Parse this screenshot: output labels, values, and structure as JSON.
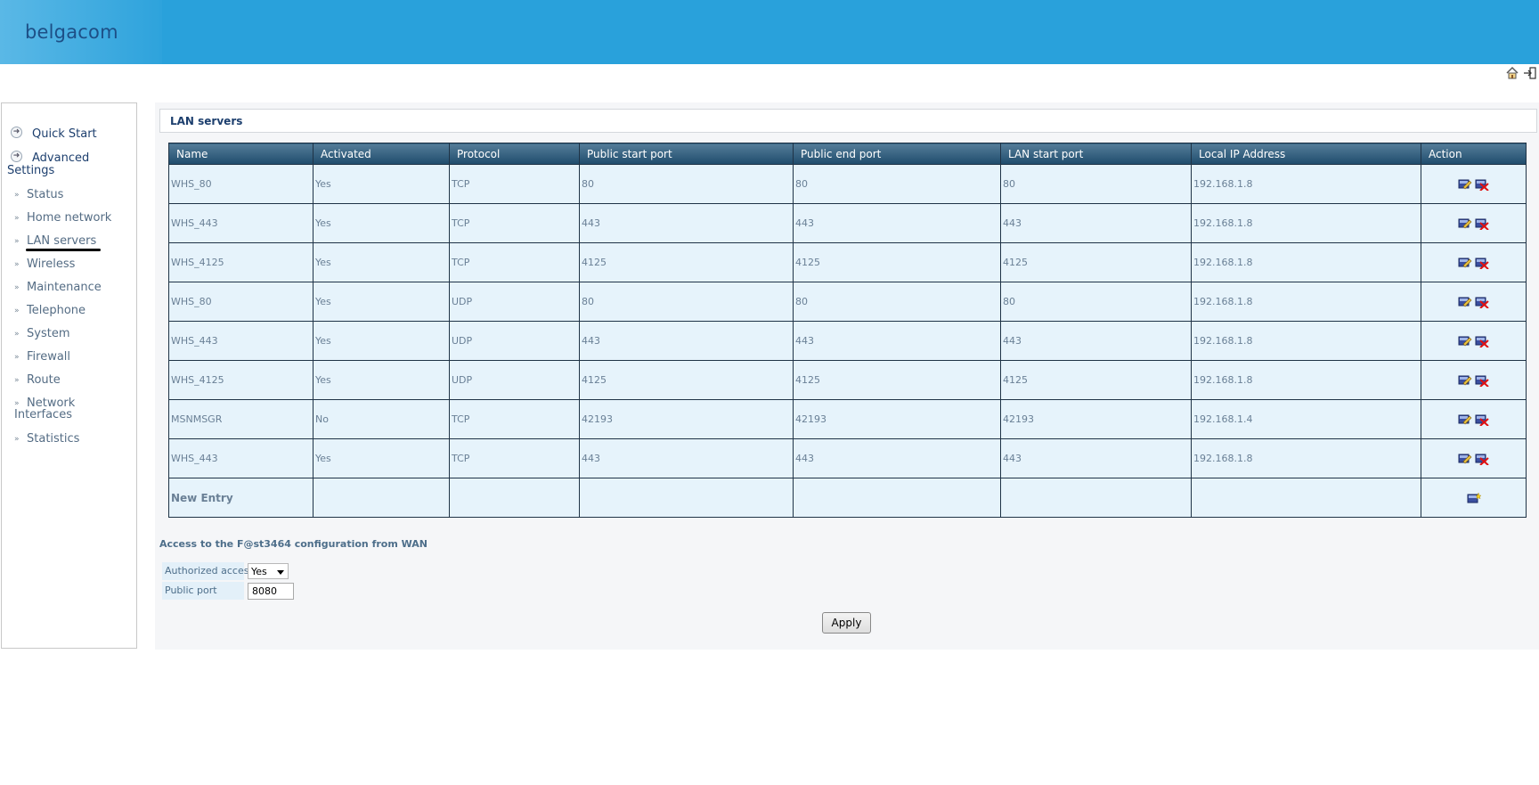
{
  "header": {
    "logo_text": "belgacom"
  },
  "top_icons": {
    "home": "home-icon",
    "logout": "logout-icon"
  },
  "sidebar": {
    "main": [
      {
        "label": "Quick Start"
      },
      {
        "label_line1": "Advanced",
        "label_line2": "Settings"
      }
    ],
    "items": [
      {
        "label": "Status"
      },
      {
        "label": "Home network"
      },
      {
        "label": "LAN servers"
      },
      {
        "label": "Wireless"
      },
      {
        "label": "Maintenance"
      },
      {
        "label": "Telephone"
      },
      {
        "label": "System"
      },
      {
        "label": "Firewall"
      },
      {
        "label": "Route"
      },
      {
        "label_line1": "Network",
        "label_line2": "Interfaces"
      },
      {
        "label": "Statistics"
      }
    ]
  },
  "page": {
    "title": "LAN servers"
  },
  "table": {
    "headers": [
      "Name",
      "Activated",
      "Protocol",
      "Public start port",
      "Public end port",
      "LAN start port",
      "Local IP Address",
      "Action"
    ],
    "rows": [
      {
        "name": "WHS_80",
        "activated": "Yes",
        "protocol": "TCP",
        "public_start": "80",
        "public_end": "80",
        "lan_start": "80",
        "ip": "192.168.1.8"
      },
      {
        "name": "WHS_443",
        "activated": "Yes",
        "protocol": "TCP",
        "public_start": "443",
        "public_end": "443",
        "lan_start": "443",
        "ip": "192.168.1.8"
      },
      {
        "name": "WHS_4125",
        "activated": "Yes",
        "protocol": "TCP",
        "public_start": "4125",
        "public_end": "4125",
        "lan_start": "4125",
        "ip": "192.168.1.8"
      },
      {
        "name": "WHS_80",
        "activated": "Yes",
        "protocol": "UDP",
        "public_start": "80",
        "public_end": "80",
        "lan_start": "80",
        "ip": "192.168.1.8"
      },
      {
        "name": "WHS_443",
        "activated": "Yes",
        "protocol": "UDP",
        "public_start": "443",
        "public_end": "443",
        "lan_start": "443",
        "ip": "192.168.1.8"
      },
      {
        "name": "WHS_4125",
        "activated": "Yes",
        "protocol": "UDP",
        "public_start": "4125",
        "public_end": "4125",
        "lan_start": "4125",
        "ip": "192.168.1.8"
      },
      {
        "name": "MSNMSGR",
        "activated": "No",
        "protocol": "TCP",
        "public_start": "42193",
        "public_end": "42193",
        "lan_start": "42193",
        "ip": "192.168.1.4"
      },
      {
        "name": "WHS_443",
        "activated": "Yes",
        "protocol": "TCP",
        "public_start": "443",
        "public_end": "443",
        "lan_start": "443",
        "ip": "192.168.1.8"
      }
    ],
    "new_entry_label": "New Entry"
  },
  "wan": {
    "title": "Access to the F@st3464 configuration from WAN",
    "authorized_label": "Authorized access",
    "authorized_value": "Yes",
    "port_label": "Public port",
    "port_value": "8080"
  },
  "apply_label": "Apply",
  "colors": {
    "header_bg": "#29a1db",
    "table_header": "#1f4c6c",
    "row_bg": "#e6f3fb"
  }
}
